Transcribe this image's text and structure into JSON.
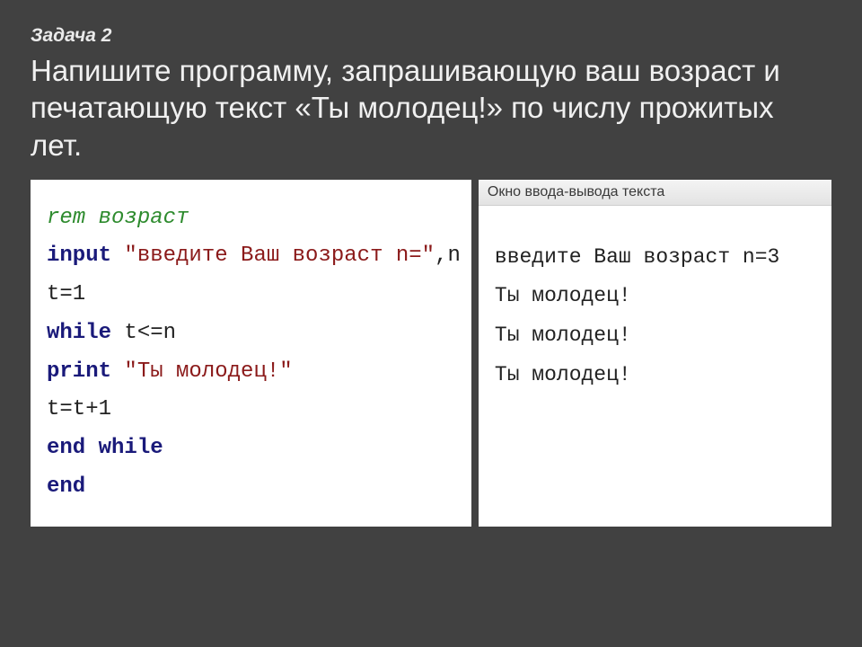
{
  "header": {
    "task_label": "Задача 2",
    "task_text": "Напишите программу, запрашивающую ваш возраст и печатающую текст «Ты молодец!» по числу прожитых лет."
  },
  "code": {
    "l1a": "rem",
    "l1b": " возраст",
    "l2a": "input ",
    "l2b": "\"введите Ваш возраст n=\"",
    "l2c": ",n",
    "l3": "t=1",
    "l4a": "while ",
    "l4b": "t<=n",
    "l5a": "print ",
    "l5b": "\"Ты молодец!\"",
    "l6": "t=t+1",
    "l7": "end while",
    "l8": "end"
  },
  "io": {
    "title": "Окно ввода-вывода текста",
    "o1": "введите Ваш возраст n=3",
    "o2": "Ты молодец!",
    "o3": "Ты молодец!",
    "o4": "Ты молодец!"
  }
}
